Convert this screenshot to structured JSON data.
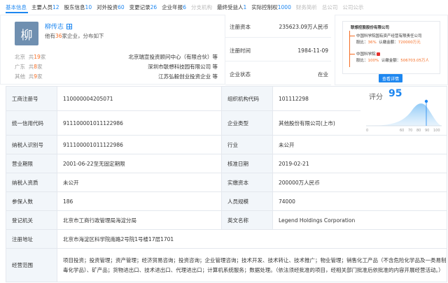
{
  "tabs": [
    {
      "label": "基本信息",
      "count": "",
      "state": "active"
    },
    {
      "label": "主要人员",
      "count": "12",
      "state": "normal"
    },
    {
      "label": "股东信息",
      "count": "10",
      "state": "normal"
    },
    {
      "label": "对外投资",
      "count": "60",
      "state": "normal"
    },
    {
      "label": "变更记录",
      "count": "26",
      "state": "normal"
    },
    {
      "label": "企业年报",
      "count": "6",
      "state": "normal"
    },
    {
      "label": "分支机构",
      "count": "",
      "state": "dim"
    },
    {
      "label": "最终受益人",
      "count": "1",
      "state": "normal"
    },
    {
      "label": "实际控制权",
      "count": "1000",
      "state": "normal"
    },
    {
      "label": "财务简析",
      "count": "",
      "state": "dim"
    },
    {
      "label": "总公司",
      "count": "",
      "state": "dim"
    },
    {
      "label": "公司公示",
      "count": "",
      "state": "dim"
    }
  ],
  "person": {
    "avatar_char": "柳",
    "name": "柳传志",
    "sub_prefix": "他有",
    "sub_count": "36",
    "sub_suffix": "家企业，分布如下",
    "regions": [
      {
        "name": "北京",
        "prefix": "共",
        "count": "19",
        "suffix": "家",
        "company": "北京瑞宣投资顾问中心（有限合伙）等"
      },
      {
        "name": "广东",
        "prefix": "共",
        "count": "8",
        "suffix": "家",
        "company": "深圳市联想科技园有限公司 等"
      },
      {
        "name": "其他",
        "prefix": "共",
        "count": "9",
        "suffix": "家",
        "company": "江苏弘毅创业投资企业 等"
      }
    ]
  },
  "summary": [
    {
      "label": "注册资本",
      "value": "235623.09万人民币"
    },
    {
      "label": "注册时间",
      "value": "1984-11-09"
    },
    {
      "label": "企业状态",
      "value": "在业"
    }
  ],
  "relation": {
    "root": "联想控股股份有限公司",
    "child1": "中国科学院国有资产经营有限责任公司",
    "child1_share_label": "股比：",
    "child1_share": "36%",
    "child1_cap_label": "认缴金额：",
    "child1_cap": "720000万元",
    "child2": "中国科学院",
    "child2_share_label": "股比：",
    "child2_share": "100%",
    "child2_cap_label": "认缴金额：",
    "child2_cap": "506703.05万人",
    "button": "查看详情"
  },
  "score": {
    "label": "评分",
    "value": "95",
    "ticks": [
      "0",
      "60",
      "70",
      "80",
      "90",
      "100"
    ]
  },
  "table": [
    {
      "k1": "工商注册号",
      "v1": "110000004205071",
      "k2": "组织机构代码",
      "v2": "101112298"
    },
    {
      "k1": "统一信用代码",
      "v1": "911100001011122986",
      "k2": "企业类型",
      "v2": "其他股份有限公司(上市)"
    },
    {
      "k1": "纳税人识别号",
      "v1": "911100001011122986",
      "k2": "行业",
      "v2": "未公开"
    },
    {
      "k1": "营业期限",
      "v1": "2001-06-22至无固定期限",
      "k2": "核准日期",
      "v2": "2019-02-21"
    },
    {
      "k1": "纳税人资质",
      "v1": "未公开",
      "k2": "实缴资本",
      "v2": "200000万人民币"
    },
    {
      "k1": "参保人数",
      "v1": "186",
      "k2": "人员规模",
      "v2": "74000"
    },
    {
      "k1": "登记机关",
      "v1": "北京市工商行政管理局海淀分局",
      "k2": "英文名称",
      "v2": "Legend Holdings Corporation"
    }
  ],
  "address": {
    "label": "注册地址",
    "value": "北京市海淀区科学院南路2号院1号楼17层1701"
  },
  "scope": {
    "label": "经营范围",
    "value": "项目投资；投资管理；资产管理；经济贸易咨询；投资咨询；企业管理咨询；技术开发、技术转让、技术推广；物业管理；销售化工产品（不含危险化学品及一类易制毒化学品）、矿产品；货物进出口、技术进出口、代理进出口；计算机系统服务；数据处理。（依法须经批准的项目，经相关部门批准后依批准的内容开展经营活动。）"
  }
}
